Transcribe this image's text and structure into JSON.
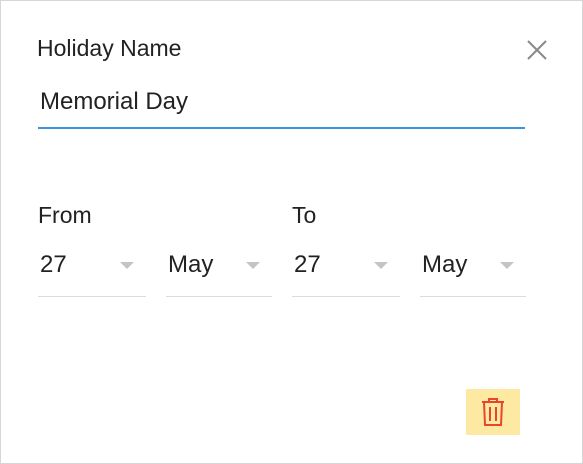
{
  "dialog": {
    "holiday_name_label": "Holiday Name",
    "holiday_name_value": "Memorial Day",
    "close_icon": "close-icon",
    "from_label": "From",
    "to_label": "To",
    "from_day": "27",
    "from_month": "May",
    "to_day": "27",
    "to_month": "May",
    "delete_icon": "trash-icon"
  },
  "colors": {
    "accent": "#3a95e0",
    "delete_bg": "#fde9a1",
    "delete_icon": "#e8452c"
  }
}
